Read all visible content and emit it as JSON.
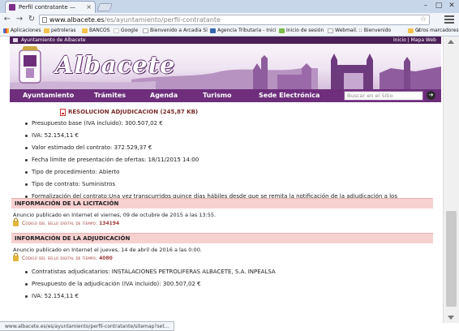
{
  "browser": {
    "tab_title": "Perfil contratante —",
    "url_host": "www.albacete.es",
    "url_path": "/es/ayuntamiento/perfil-contratante",
    "status_url": "www.albacete.es/es/ayuntamiento/perfil-contratante/sitemap?set...",
    "bookmarks": [
      {
        "label": "Aplicaciones",
        "icon": "apps-icon"
      },
      {
        "label": "petroleras",
        "icon": "folder-icon"
      },
      {
        "label": "BANCOS",
        "icon": "folder-icon"
      },
      {
        "label": "Google",
        "icon": "google-icon"
      },
      {
        "label": "Bienvenido a Arcadia Si",
        "icon": "web-icon"
      },
      {
        "label": "Agencia Tributaria - Inici",
        "icon": "aeat-icon"
      },
      {
        "label": "Inicio de sesión",
        "icon": "green-icon"
      },
      {
        "label": "Webmail. :: Bienvenido",
        "icon": "web-icon"
      }
    ],
    "bookmarks_more": "»",
    "other_bookmarks": "Otros marcadores"
  },
  "site": {
    "top_strip_title": "Ayuntamiento de Albacete",
    "top_links": "Inicio | Mapa Web",
    "logo": "Albacete",
    "nav": [
      "Ayuntamiento",
      "Trámites",
      "Agenda",
      "Turismo",
      "Sede Electrónica"
    ],
    "search_placeholder": "Buscar en el Sitio"
  },
  "content": {
    "resolution_link": "RESOLUCION ADJUDICACION (245,87 KB)",
    "details": [
      "Presupuesto base (IVA incluido): 300.507,02 €",
      "IVA: 52.154,11 €",
      "Valor estimado del contrato: 372.529,37 €",
      "Fecha límite de presentación de ofertas: 18/11/2015 14:00",
      "Tipo de procedimiento: Abierto",
      "Tipo de contrato: Suministros",
      "Formalización del contrato:Una vez transcurridos quince días hábiles desde que se remita la notificación de la adjudicación a los licitadores y dentro de los cinco días siguientes contados desde la recepción del requerimiento para la formalización."
    ],
    "licitacion": {
      "heading": "INFORMACIÓN DE LA LICITACIÓN",
      "published": "Anuncio publicado en Internet el viernes, 09 de octubre de 2015 a las 13:55.",
      "seal_label": "Código del sello digital de tiempo:",
      "seal_code": "134194"
    },
    "adjudicacion": {
      "heading": "INFORMACIÓN DE LA ADJUDICACIÓN",
      "published": "Anuncio publicado en Internet el jueves, 14 de abril de 2016 a las 0:00.",
      "seal_label": "Código del sello digital de tiempo:",
      "seal_code": "4080",
      "items": [
        "Contratistas adjudicatarios: INSTALACIONES PETROLIFERAS ALBACETE, S.A. INPEALSA",
        "Presupuesto de la adjudicación (IVA incluido): 300.507,02 €",
        "IVA: 52.154,11 €"
      ]
    }
  }
}
